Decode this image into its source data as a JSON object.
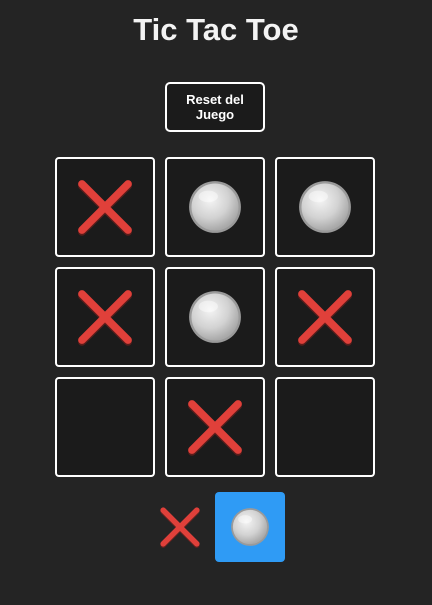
{
  "title": "Tic Tac Toe",
  "reset_label": "Reset del Juego",
  "board": [
    "x",
    "o",
    "o",
    "x",
    "o",
    "x",
    "",
    "x",
    ""
  ],
  "turn": {
    "players": [
      "x",
      "o"
    ],
    "current": "o"
  },
  "icons": {
    "x": "x-mark-icon",
    "o": "circle-icon"
  },
  "colors": {
    "background": "#242424",
    "cell_border": "#ffffff",
    "x_color": "#e0403a",
    "o_color": "#d2d2d2",
    "active_turn": "#2f9bf5"
  }
}
